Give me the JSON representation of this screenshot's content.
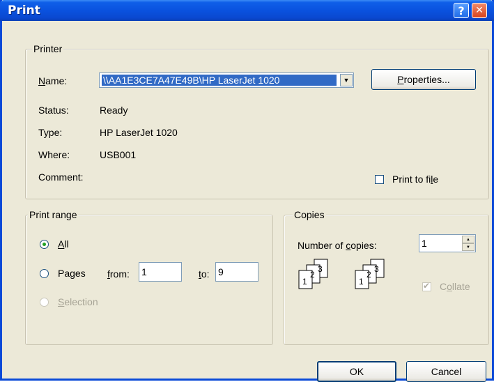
{
  "window": {
    "title": "Print"
  },
  "printer": {
    "legend": "Printer",
    "name_label": "Name:",
    "name_value": "\\\\AA1E3CE7A47E49B\\HP LaserJet 1020",
    "properties_label": "Properties...",
    "status_label": "Status:",
    "status_value": "Ready",
    "type_label": "Type:",
    "type_value": "HP LaserJet 1020",
    "where_label": "Where:",
    "where_value": "USB001",
    "comment_label": "Comment:",
    "print_to_file_label": "Print to file",
    "print_to_file_checked": false
  },
  "print_range": {
    "legend": "Print range",
    "all_label": "All",
    "pages_label": "Pages",
    "from_label": "from:",
    "from_value": "1",
    "to_label": "to:",
    "to_value": "9",
    "selection_label": "Selection",
    "selected": "All"
  },
  "copies": {
    "legend": "Copies",
    "number_label": "Number of copies:",
    "number_value": "1",
    "collate_label": "Collate",
    "collate_checked": true,
    "page_numbers": [
      "1",
      "2",
      "3"
    ]
  },
  "buttons": {
    "ok_label": "OK",
    "cancel_label": "Cancel"
  }
}
